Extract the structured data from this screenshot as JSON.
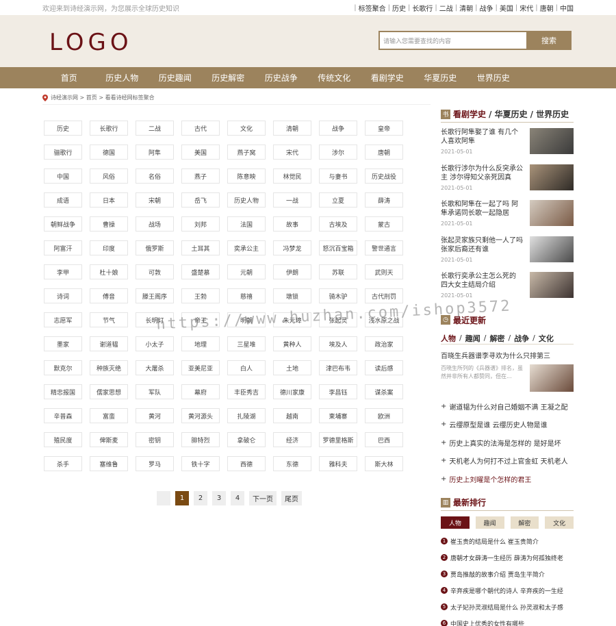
{
  "topbar": {
    "welcome": "欢迎来到诗经演示网，为您展示全球历史知识",
    "links": [
      "标签聚合",
      "历史",
      "长歌行",
      "二战",
      "清朝",
      "战争",
      "美国",
      "宋代",
      "唐朝",
      "中国"
    ]
  },
  "header": {
    "logo": "LOGO",
    "search_placeholder": "请输入您需要查找的内容",
    "search_button": "搜索"
  },
  "nav": [
    "首页",
    "历史人物",
    "历史趣闻",
    "历史解密",
    "历史战争",
    "传统文化",
    "看剧学史",
    "华夏历史",
    "世界历史"
  ],
  "breadcrumb": "诗经演示网 > 首页 > 看看诗经网标签聚合",
  "tags": [
    "历史",
    "长歌行",
    "二战",
    "古代",
    "文化",
    "清朝",
    "战争",
    "皇帝",
    "骊歌行",
    "德国",
    "阿隼",
    "美国",
    "燕子窝",
    "宋代",
    "涉尔",
    "唐朝",
    "中国",
    "风俗",
    "名俗",
    "燕子",
    "陈意映",
    "林觉民",
    "与妻书",
    "历史战役",
    "成语",
    "日本",
    "宋朝",
    "岳飞",
    "历史人物",
    "一战",
    "立夏",
    "薛涛",
    "朝鲜战争",
    "曹操",
    "战场",
    "刘邦",
    "法国",
    "故事",
    "古埃及",
    "蒙古",
    "阿富汗",
    "印度",
    "俄罗斯",
    "土耳其",
    "奕承公主",
    "冯梦龙",
    "怒沉百宝箱",
    "警世通言",
    "李甲",
    "杜十娘",
    "可敦",
    "盛楚慕",
    "元朝",
    "伊朗",
    "苏联",
    "武则天",
    "诗词",
    "傅音",
    "滕王阁序",
    "王勃",
    "慈禧",
    "墩锁",
    "骑木驴",
    "古代刑罚",
    "志愿军",
    "节气",
    "长明灯",
    "帝王",
    "明朝",
    "朱元璋",
    "张起灵",
    "浅水原之战",
    "墨家",
    "谢道韫",
    "小太子",
    "地理",
    "三星堆",
    "黄种人",
    "埃及人",
    "政治家",
    "默克尔",
    "种族灭绝",
    "大屠杀",
    "亚美尼亚",
    "白人",
    "土地",
    "津巴布韦",
    "读后感",
    "精忠报国",
    "儒家思想",
    "军队",
    "幕府",
    "丰臣秀吉",
    "德川家康",
    "李昌钰",
    "谋杀案",
    "辛普森",
    "富蛮",
    "黄河",
    "黄河源头",
    "扎陵湖",
    "越南",
    "柬埔寨",
    "欧洲",
    "殖民度",
    "俾斯麦",
    "密钥",
    "腓特烈",
    "拿破仑",
    "经济",
    "罗德里格斯",
    "巴西",
    "杀手",
    "塞维鲁",
    "罗马",
    "铁十字",
    "西德",
    "东德",
    "雅科夫",
    "斯大林"
  ],
  "pager": {
    "pages": [
      "1",
      "2",
      "3",
      "4"
    ],
    "current": "1",
    "next": "下一页",
    "last": "尾页"
  },
  "sidebar": {
    "section1": {
      "icon": "书",
      "title": "看剧学史",
      "extra": [
        "/ 华夏历史",
        "/ 世界历史"
      ]
    },
    "news": [
      {
        "title": "长歌行阿隼娶了谁 有几个人喜欢阿隼",
        "date": "2021-05-01"
      },
      {
        "title": "长歌行涉尔为什么反突承公主 涉尔得知父亲死因真",
        "date": "2021-05-01"
      },
      {
        "title": "长歌和阿隼在一起了吗 阿隼承诺同长歌一起隐居",
        "date": "2021-05-01"
      },
      {
        "title": "张起灵家族只剩他一人了吗 张家后裔还有谁",
        "date": "2021-05-01"
      },
      {
        "title": "长歌行奕承公主怎么死的 四大女主结局介绍",
        "date": "2021-05-01"
      }
    ],
    "latest": {
      "icon": "◷",
      "title": "最近更新",
      "tabs": [
        "人物",
        "趣闻",
        "解密",
        "战争",
        "文化"
      ],
      "featured_title": "百晓生兵器谱李寻欢为什么只排第三",
      "featured_desc": "百晓生所列的《兵器谱》排名，虽然并非所有人都赞同，但在...",
      "items": [
        "谢道韫为什么对自己婚姻不满 王凝之配",
        "云缨原型是谁 云缨历史人物是谁",
        "历史上真实的法海是怎样的 是好是坏",
        "天机老人为何打不过上官金虹 天机老人",
        "历史上刘曜是个怎样的君王"
      ]
    },
    "ranking": {
      "icon": "▥",
      "title": "最新排行",
      "tabs": [
        "人物",
        "趣闻",
        "解密",
        "文化"
      ],
      "items": [
        "崔玉贵的结局是什么 崔玉贵简介",
        "唐朝才女薛涛一生经历 薛涛为何孤独终老",
        "贾岛推敲的故事介绍 贾岛生平简介",
        "辛弃疾是哪个朝代的诗人 辛弃疾的一生经",
        "太子妃孙灵淑结局是什么 孙灵淑和太子感",
        "中国史上优秀的女性有哪些"
      ]
    }
  },
  "watermark": "https://www.huzhan.com/ishop3572"
}
